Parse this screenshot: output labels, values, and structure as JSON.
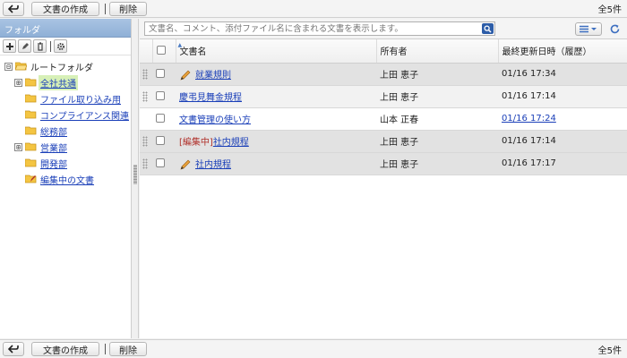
{
  "toolbar": {
    "create_label": "文書の作成",
    "delete_label": "削除",
    "count": "全5件"
  },
  "folder_panel": {
    "title": "フォルダ",
    "tree": [
      {
        "label": "ルートフォルダ",
        "level": 0,
        "expander": "⊟",
        "link": false
      },
      {
        "label": "全社共通",
        "level": 1,
        "expander": "⊞",
        "link": true,
        "selected": true
      },
      {
        "label": "ファイル取り込み用",
        "level": 1,
        "expander": "",
        "link": true
      },
      {
        "label": "コンプライアンス関連",
        "level": 1,
        "expander": "",
        "link": true
      },
      {
        "label": "総務部",
        "level": 1,
        "expander": "",
        "link": true
      },
      {
        "label": "営業部",
        "level": 1,
        "expander": "⊞",
        "link": true
      },
      {
        "label": "開発部",
        "level": 1,
        "expander": "",
        "link": true
      },
      {
        "label": "編集中の文書",
        "level": 1,
        "expander": "",
        "link": true,
        "special": true
      }
    ]
  },
  "search": {
    "placeholder": "文書名、コメント、添付ファイル名に含まれる文書を表示します。"
  },
  "table": {
    "columns": {
      "name": "文書名",
      "owner": "所有者",
      "updated": "最終更新日時（履歴）"
    },
    "rows": [
      {
        "pencil": true,
        "tag": "",
        "name": "就業規則",
        "owner": "上田 恵子",
        "updated": "01/16 17:34",
        "updated_link": false,
        "shade": "gray"
      },
      {
        "pencil": false,
        "tag": "",
        "name": "慶弔見舞金規程",
        "owner": "上田 恵子",
        "updated": "01/16 17:14",
        "updated_link": false,
        "shade": "light"
      },
      {
        "pencil": false,
        "tag": "",
        "name": "文書管理の使い方",
        "owner": "山本 正春",
        "updated": "01/16 17:24",
        "updated_link": true,
        "shade": "white"
      },
      {
        "pencil": false,
        "tag": "[編集中]",
        "name": "社内規程",
        "owner": "上田 恵子",
        "updated": "01/16 17:14",
        "updated_link": false,
        "shade": "gray"
      },
      {
        "pencil": true,
        "tag": "",
        "name": "社内規程",
        "owner": "上田 恵子",
        "updated": "01/16 17:17",
        "updated_link": false,
        "shade": "gray"
      }
    ]
  },
  "colors": {
    "panel_header": "#9bbae0",
    "link": "#1a3fb8",
    "selected": "#d7f0b7",
    "edit_tag": "#b0302a"
  },
  "icons": [
    "back-arrow-icon",
    "plus-icon",
    "pencil-icon",
    "trash-icon",
    "gear-icon",
    "folder-icon",
    "search-icon",
    "list-view-icon",
    "refresh-icon"
  ]
}
